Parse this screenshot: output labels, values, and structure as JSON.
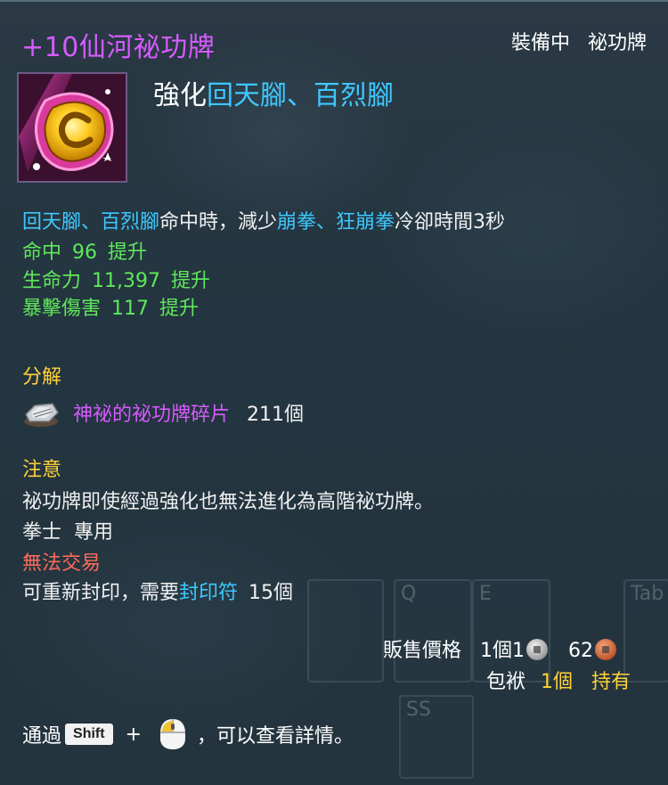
{
  "item": {
    "name": "+10仙河祕功牌",
    "status_equipped": "裝備中",
    "status_type": "祕功牌",
    "enhance_prefix": "強化",
    "enhance_skills": "回天腳、百烈腳"
  },
  "effect": {
    "trigger_skills": "回天腳、百烈腳",
    "mid_text": "命中時，減少",
    "target_skills": "崩拳、狂崩拳",
    "end_text": "冷卻時間3秒"
  },
  "stats": [
    {
      "name": "命中",
      "value": "96",
      "suffix": "提升"
    },
    {
      "name": "生命力",
      "value": "11,397",
      "suffix": "提升"
    },
    {
      "name": "暴擊傷害",
      "value": "117",
      "suffix": "提升"
    }
  ],
  "disassemble": {
    "header": "分解",
    "material_name": "神祕的祕功牌碎片",
    "material_count": "211個"
  },
  "notice": {
    "header": "注意",
    "text": "祕功牌即使經過強化也無法進化為高階祕功牌。",
    "class_only": "拳士  專用",
    "untradeable": "無法交易",
    "reseal_prefix": "可重新封印，需要",
    "reseal_item": "封印符",
    "reseal_count": "15個"
  },
  "price": {
    "label": "販售價格",
    "unit_text": "1個1",
    "bronze": "62"
  },
  "inventory": {
    "label": "包袱",
    "count": "1個",
    "owned": "持有"
  },
  "hint": {
    "prefix": "通過",
    "key": "Shift",
    "plus": "+",
    "suffix": "，可以查看詳情。"
  },
  "background_slots": [
    "Q",
    "E",
    "Tab",
    "SS"
  ],
  "colors": {
    "item_name": "#d65bff",
    "skill_highlight": "#3ec8ff",
    "stat_green": "#5fe85a",
    "section_yellow": "#ffd23a",
    "warning_red": "#ff6a5a",
    "background": "#24343e"
  }
}
